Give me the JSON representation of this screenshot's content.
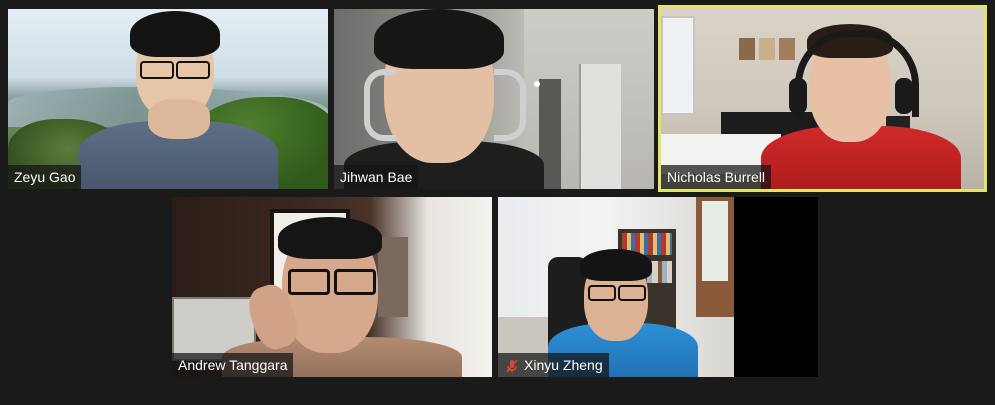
{
  "meeting": {
    "view": "gallery",
    "participants": [
      {
        "name": "Zeyu Gao",
        "active_speaker": false,
        "muted": false
      },
      {
        "name": "Jihwan Bae",
        "active_speaker": false,
        "muted": false
      },
      {
        "name": "Nicholas Burrell",
        "active_speaker": true,
        "muted": false
      },
      {
        "name": "Andrew Tanggara",
        "active_speaker": false,
        "muted": false
      },
      {
        "name": "Xinyu Zheng",
        "active_speaker": false,
        "muted": true
      }
    ]
  },
  "colors": {
    "background": "#1a1a1a",
    "active_speaker_border": "#dfe66a",
    "muted_icon": "#e0453a",
    "name_tag_bg": "#141414",
    "name_tag_text": "#ffffff"
  },
  "icons": {
    "muted": "mic-muted-icon"
  }
}
